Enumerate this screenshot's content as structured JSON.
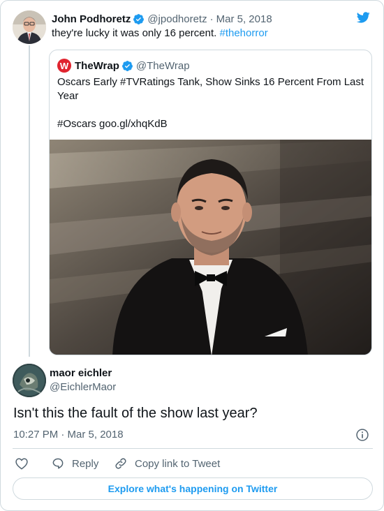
{
  "parent_tweet": {
    "author_name": "John Podhoretz",
    "author_handle": "@jpodhoretz",
    "separator": "·",
    "date": "Mar 5, 2018",
    "text": "they're lucky it was only 16 percent. ",
    "hashtag": "#thehorror"
  },
  "quoted_tweet": {
    "logo_letter": "W",
    "author_name": "TheWrap",
    "author_handle": "@TheWrap",
    "line1": "Oscars Early #TVRatings Tank, Show Sinks 16 Percent From Last Year",
    "line2": "#Oscars goo.gl/xhqKdB"
  },
  "reply_tweet": {
    "author_name": "maor eichler",
    "author_handle": "@EichlerMaor",
    "text": "Isn't this the fault of the show last year?",
    "timestamp": "10:27 PM · Mar 5, 2018"
  },
  "actions": {
    "reply_label": "Reply",
    "copy_link_label": "Copy link to Tweet"
  },
  "footer": {
    "explore_label": "Explore what's happening on Twitter"
  },
  "colors": {
    "accent": "#1d9bf0",
    "muted_text": "#536471",
    "border": "#cfd9de",
    "wrap_brand": "#e0242f"
  },
  "icons": [
    "verified-badge-icon",
    "twitter-bird-icon",
    "heart-icon",
    "reply-icon",
    "link-icon",
    "info-icon"
  ]
}
